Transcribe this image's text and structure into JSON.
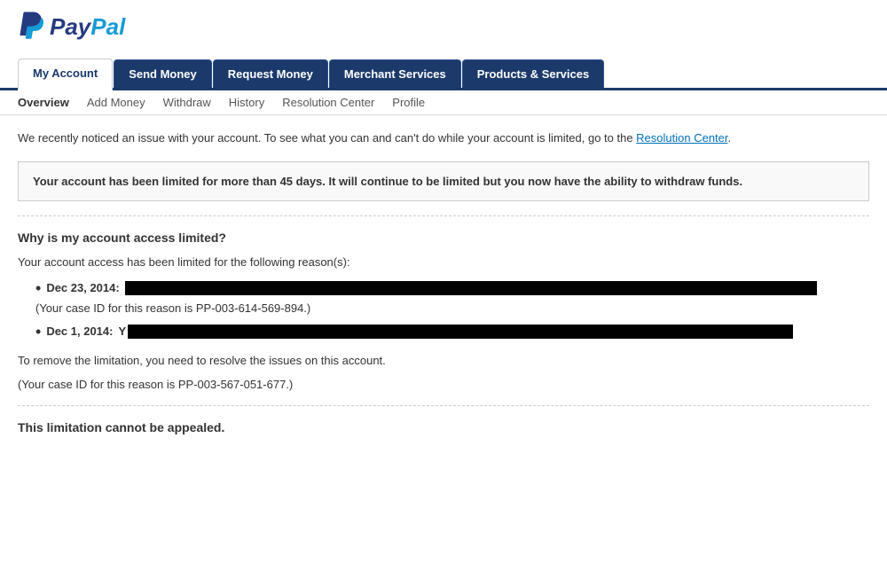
{
  "logo": {
    "pay": "Pay",
    "pal": "Pal"
  },
  "primary_nav": {
    "items": [
      {
        "label": "My Account",
        "active": true
      },
      {
        "label": "Send Money"
      },
      {
        "label": "Request Money"
      },
      {
        "label": "Merchant Services"
      },
      {
        "label": "Products & Services"
      }
    ]
  },
  "secondary_nav": {
    "items": [
      {
        "label": "Overview"
      },
      {
        "label": "Add Money"
      },
      {
        "label": "Withdraw"
      },
      {
        "label": "History"
      },
      {
        "label": "Resolution Center"
      },
      {
        "label": "Profile"
      }
    ]
  },
  "content": {
    "notice_text_before_link": "We recently noticed an issue with your account. To see what you can and can't do while your account is limited, go to the ",
    "notice_link_text": "Resolution Center",
    "notice_text_after_link": ".",
    "alert_text": "Your account has been limited for more than 45 days. It will continue to be limited but you now have the ability to withdraw funds.",
    "section_heading": "Why is my account access limited?",
    "intro_text": "Your account access has been limited for the following reason(s):",
    "reasons": [
      {
        "date": "Dec 23, 2014:",
        "redacted": true,
        "case_id_text": "(Your case ID for this reason is PP-003-614-569-894.)"
      },
      {
        "date": "Dec 1, 2014:",
        "redacted": true,
        "case_id_prefix": "Y"
      }
    ],
    "remove_limitation_text": "To remove the limitation, you need to resolve the issues on this account.",
    "case_id_second": "(Your case ID for this reason is PP-003-567-051-677.)",
    "limitation_notice": "This limitation cannot be appealed."
  }
}
